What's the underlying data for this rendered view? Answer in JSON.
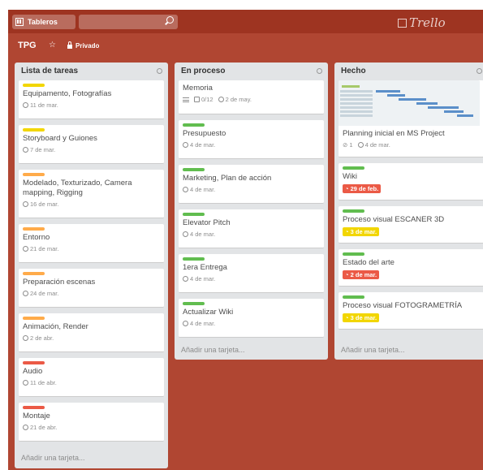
{
  "header": {
    "boards_label": "Tableros",
    "search_placeholder": "",
    "logo": "Trello"
  },
  "board": {
    "title": "TPG",
    "visibility": "Privado"
  },
  "colors": {
    "topbar": "#9e3421",
    "board_bg": "#b04632",
    "list_bg": "#e2e4e6",
    "yellow": "#f2d600",
    "orange": "#ffab4a",
    "red": "#eb5a46",
    "green": "#61bd4f",
    "due_red": "#eb5a46",
    "due_yellow": "#f2d600"
  },
  "lists": [
    {
      "title": "Lista de tareas",
      "add_card": "Añadir una tarjeta...",
      "cards": [
        {
          "title": "Equipamento, Fotografías",
          "date": "11 de mar."
        },
        {
          "title": "Storyboard y Guiones",
          "date": "7 de mar."
        },
        {
          "title": "Modelado, Texturizado, Camera mapping, Rigging",
          "date": "16 de mar."
        },
        {
          "title": "Entorno",
          "date": "21 de mar."
        },
        {
          "title": "Preparación escenas",
          "date": "24 de mar."
        },
        {
          "title": "Animación, Render",
          "date": "2 de abr."
        },
        {
          "title": "Audio",
          "date": "11 de abr."
        },
        {
          "title": "Montaje",
          "date": "21 de abr."
        }
      ]
    },
    {
      "title": "En proceso",
      "add_card": "Añadir una tarjeta...",
      "cards": [
        {
          "title": "Memoria",
          "checklist": "0/12",
          "date": "2 de may."
        },
        {
          "title": "Presupuesto",
          "date": "4 de mar."
        },
        {
          "title": "Marketing, Plan de acción",
          "date": "4 de mar."
        },
        {
          "title": "Elevator Pitch",
          "date": "4 de mar."
        },
        {
          "title": "1era Entrega",
          "date": "4 de mar."
        },
        {
          "title": "Actualizar Wiki",
          "date": "4 de mar."
        }
      ]
    },
    {
      "title": "Hecho",
      "add_card": "Añadir una tarjeta...",
      "cards": [
        {
          "title": "Planning inicial en MS Project",
          "attachments": "1",
          "date": "4 de mar."
        },
        {
          "title": "Wiki",
          "due": "29 de feb."
        },
        {
          "title": "Proceso visual ESCANER 3D",
          "due": "3 de mar."
        },
        {
          "title": "Estado del arte",
          "due": "2 de mar."
        },
        {
          "title": "Proceso visual FOTOGRAMETRÍA",
          "due": "3 de mar."
        }
      ]
    }
  ]
}
